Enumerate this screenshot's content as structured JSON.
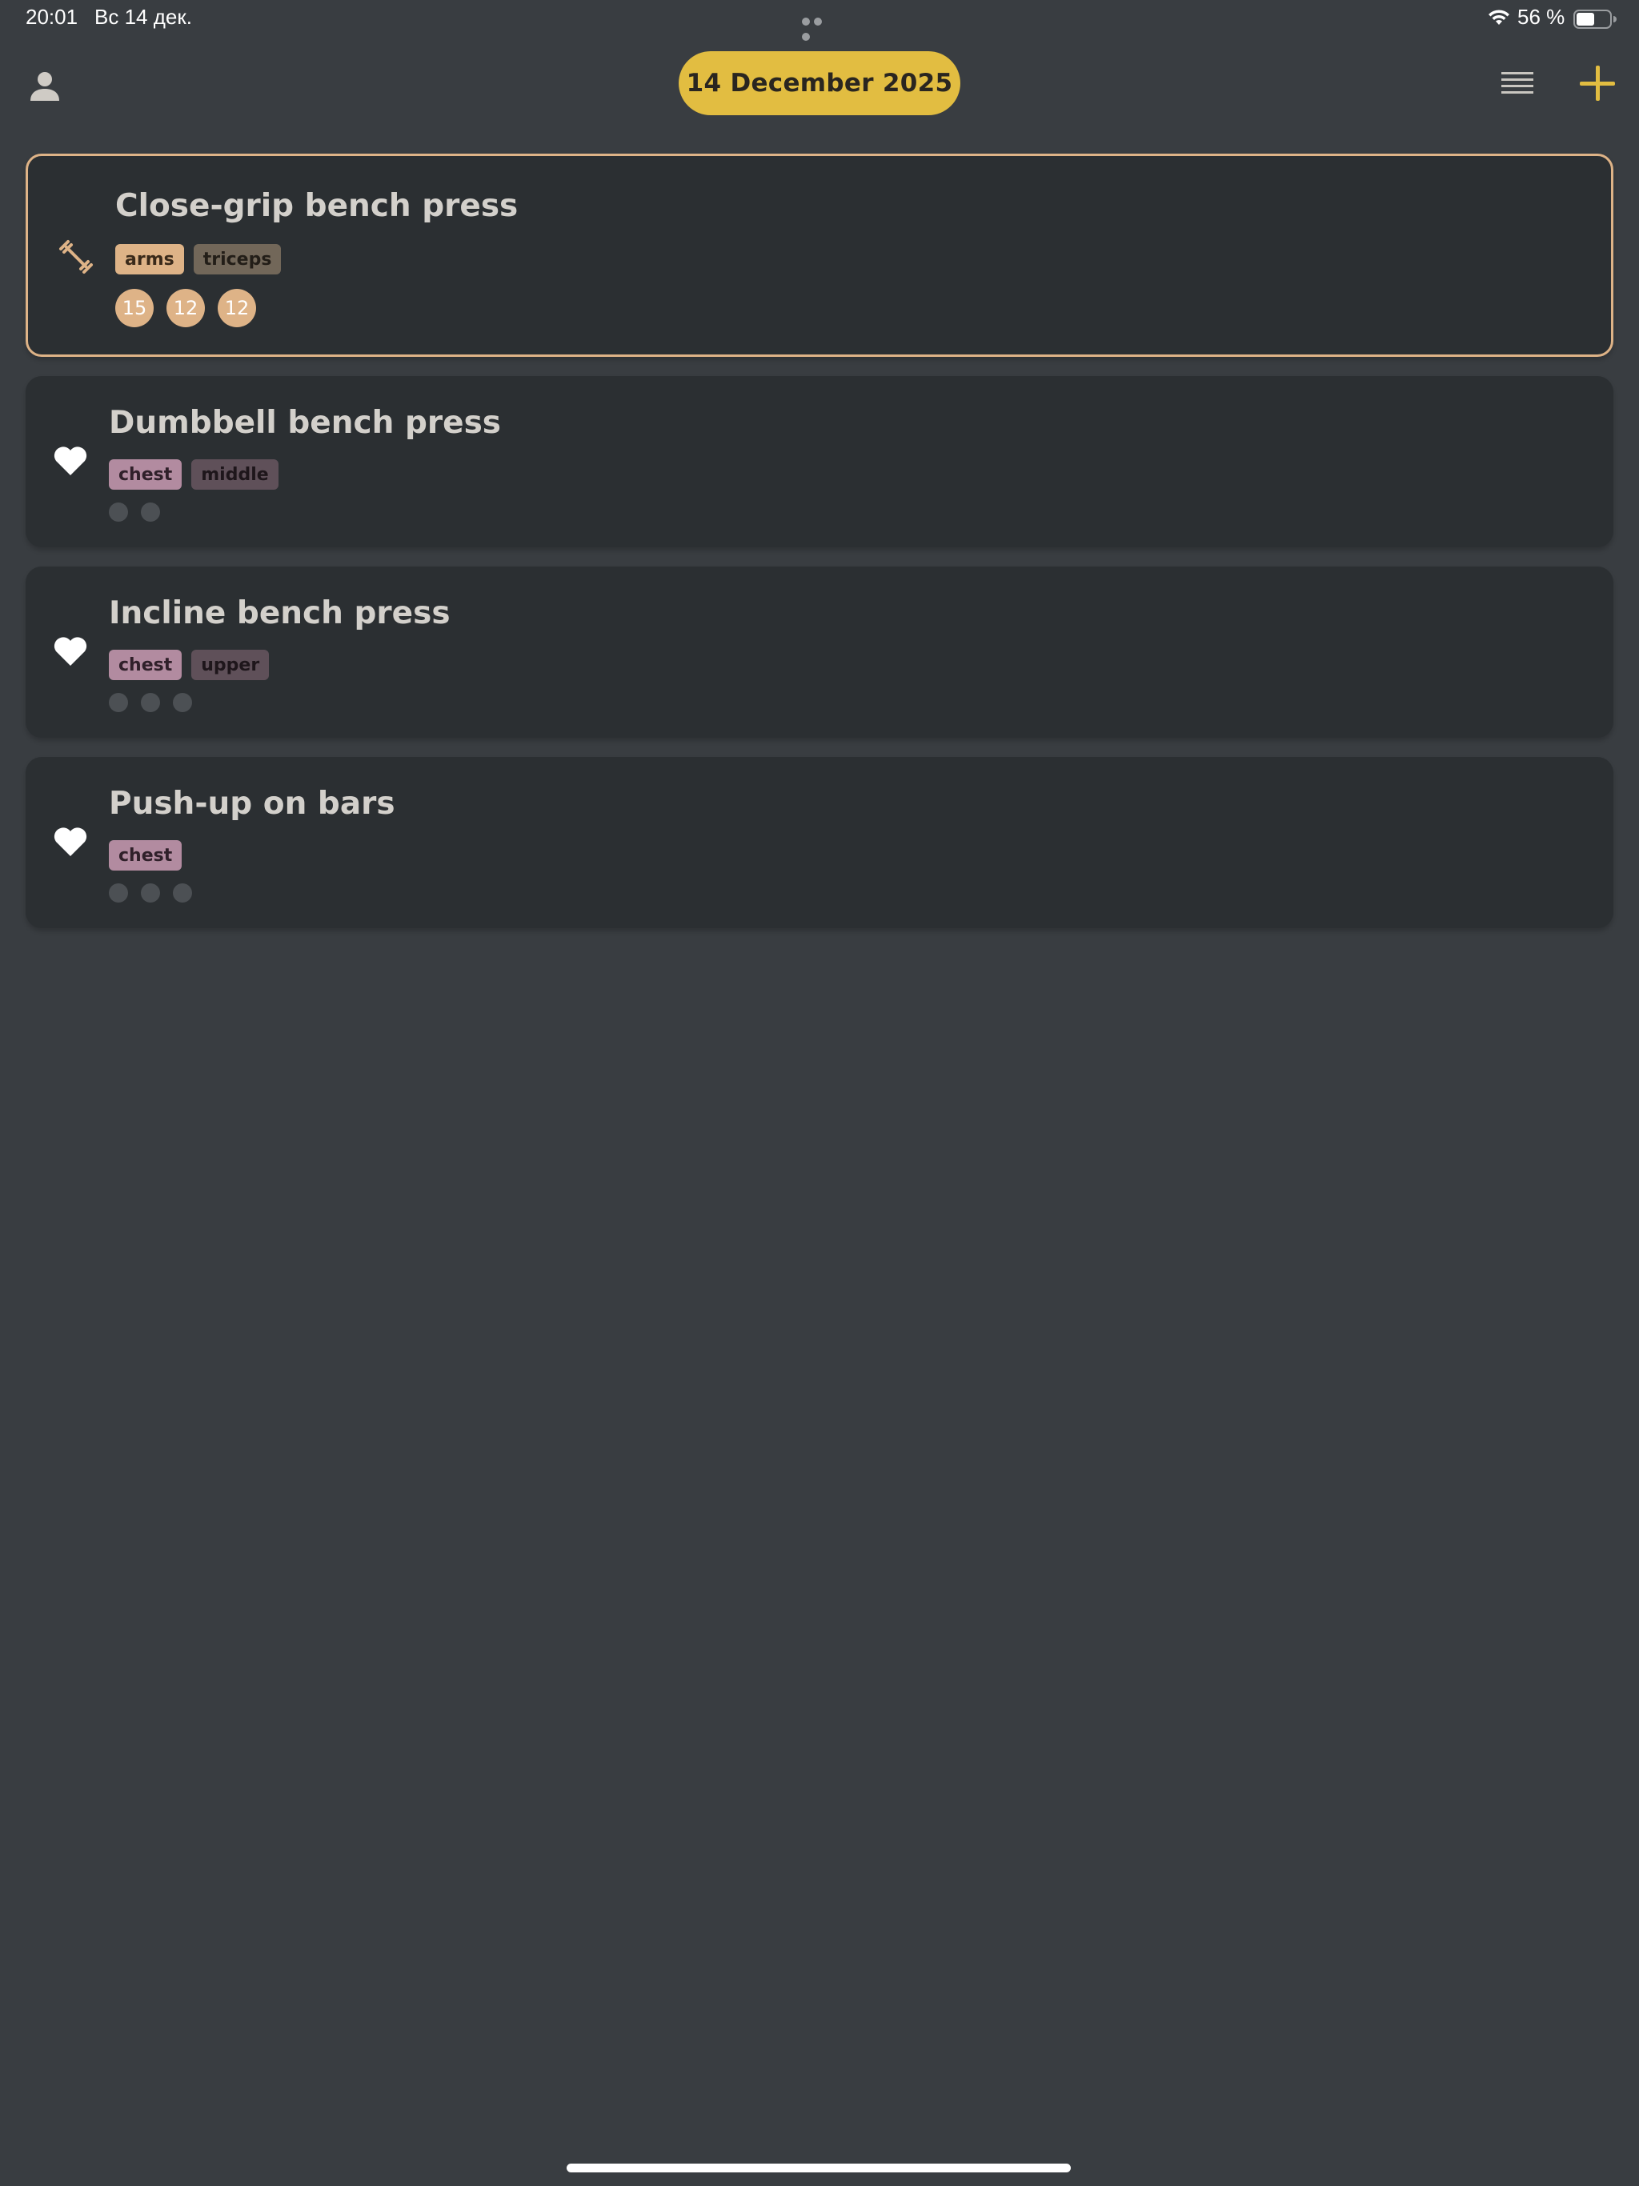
{
  "status_bar": {
    "time": "20:01",
    "date": "Вс 14 дек.",
    "battery_percent": "56 %",
    "battery_level": 0.56
  },
  "header": {
    "date_label": "14 December 2025",
    "accent_color": "#e2bd41"
  },
  "exercises": [
    {
      "title": "Close-grip bench press",
      "icon": "dumbbell-icon",
      "tags": [
        "arms",
        "triceps"
      ],
      "sets": [
        "15",
        "12",
        "12"
      ],
      "active": true
    },
    {
      "title": "Dumbbell bench press",
      "icon": "heart-icon",
      "tags": [
        "chest",
        "middle"
      ],
      "empty_sets": 2,
      "active": false
    },
    {
      "title": "Incline bench press",
      "icon": "heart-icon",
      "tags": [
        "chest",
        "upper"
      ],
      "empty_sets": 3,
      "active": false
    },
    {
      "title": "Push-up on bars",
      "icon": "heart-icon",
      "tags": [
        "chest"
      ],
      "empty_sets": 3,
      "active": false
    }
  ],
  "colors": {
    "background": "#393d41",
    "card": "#2b2f32",
    "arms_tag": "#deb387",
    "chest_tag": "#b28ba0"
  }
}
